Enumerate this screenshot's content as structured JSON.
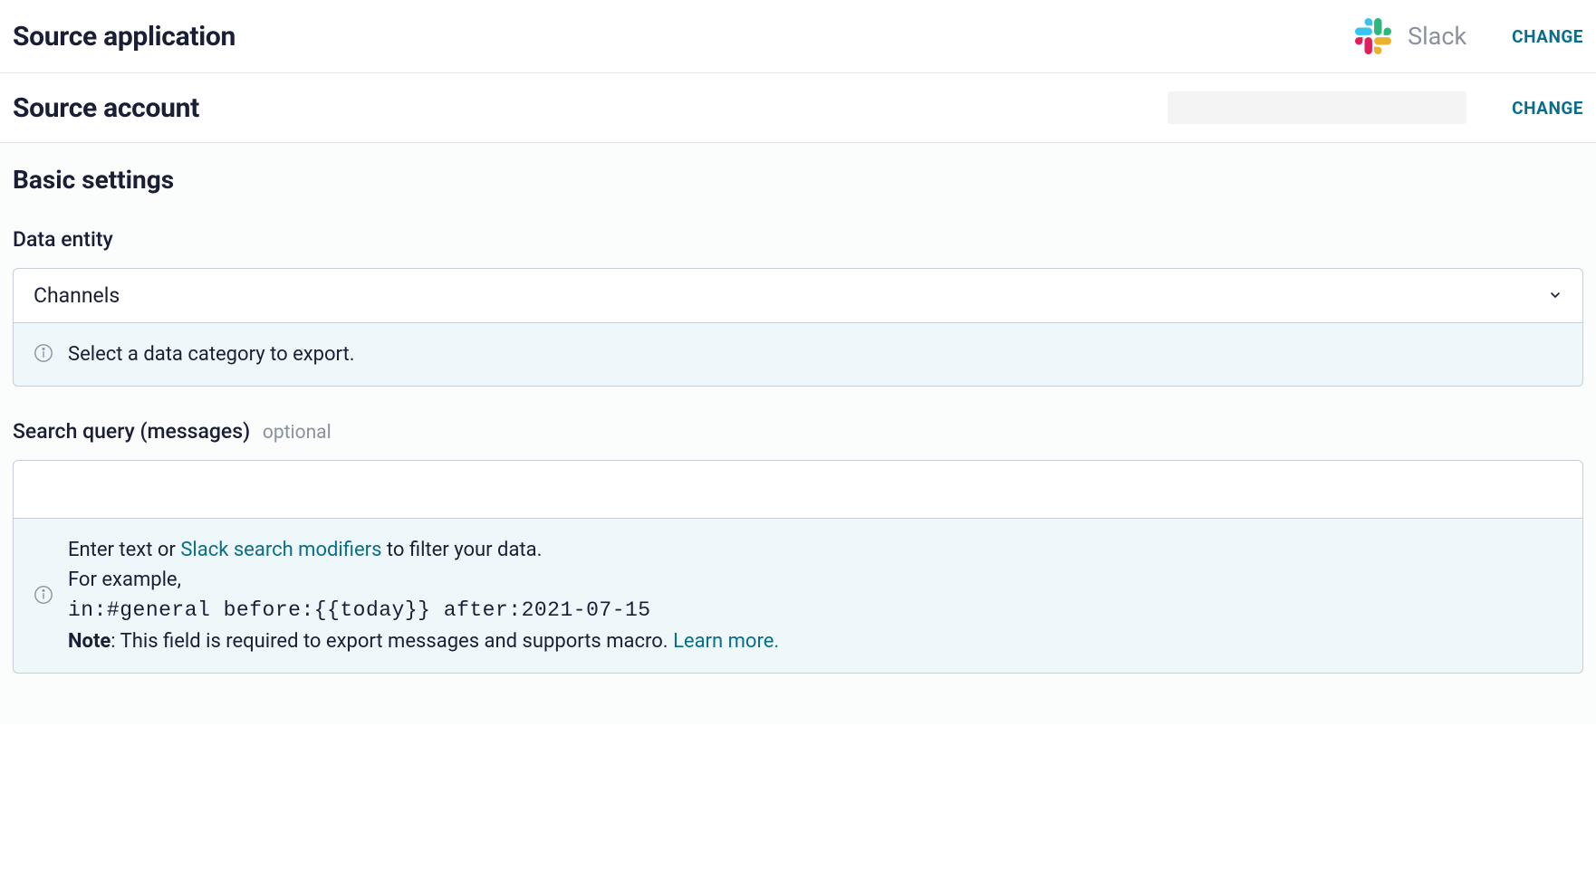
{
  "sourceApp": {
    "title": "Source application",
    "appName": "Slack",
    "changeLabel": "CHANGE"
  },
  "sourceAccount": {
    "title": "Source account",
    "changeLabel": "CHANGE"
  },
  "basicSettings": {
    "title": "Basic settings",
    "dataEntity": {
      "label": "Data entity",
      "selected": "Channels",
      "helpText": "Select a data category to export."
    },
    "searchQuery": {
      "label": "Search query (messages)",
      "optional": "optional",
      "value": "",
      "help": {
        "prefix": "Enter text or ",
        "linkText": "Slack search modifiers",
        "suffix": " to filter your data.",
        "example": "For example,",
        "code": "in:#general before:{{today}} after:2021-07-15",
        "noteLabel": "Note",
        "noteText": ": This field is required to export messages and supports macro. ",
        "learnMore": "Learn more."
      }
    }
  }
}
